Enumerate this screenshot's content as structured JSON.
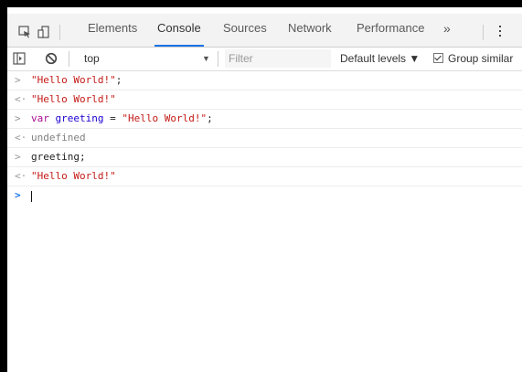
{
  "tabbar": {
    "tabs": [
      {
        "label": "Elements"
      },
      {
        "label": "Console"
      },
      {
        "label": "Sources"
      },
      {
        "label": "Network"
      },
      {
        "label": "Performance"
      }
    ],
    "more_label": "»",
    "active_tab": "Console"
  },
  "toolbar": {
    "context": "top",
    "filter_placeholder": "Filter",
    "levels_label": "Default levels ▼",
    "group_similar_label": "Group similar",
    "group_similar_checked": true
  },
  "console": {
    "rows": [
      {
        "type": "input",
        "marker": ">",
        "parts": [
          {
            "text": "\"Hello World!\"",
            "style": "str"
          },
          {
            "text": ";",
            "style": "plain"
          }
        ]
      },
      {
        "type": "output",
        "marker": "<·",
        "parts": [
          {
            "text": "\"Hello World!\"",
            "style": "str"
          }
        ]
      },
      {
        "type": "input",
        "marker": ">",
        "parts": [
          {
            "text": "var ",
            "style": "kw"
          },
          {
            "text": "greeting",
            "style": "var"
          },
          {
            "text": " = ",
            "style": "plain"
          },
          {
            "text": "\"Hello World!\"",
            "style": "str"
          },
          {
            "text": ";",
            "style": "plain"
          }
        ]
      },
      {
        "type": "output",
        "marker": "<·",
        "parts": [
          {
            "text": "undefined",
            "style": "undef"
          }
        ]
      },
      {
        "type": "input",
        "marker": ">",
        "parts": [
          {
            "text": "greeting;",
            "style": "plain"
          }
        ]
      },
      {
        "type": "output",
        "marker": "<·",
        "parts": [
          {
            "text": "\"Hello World!\"",
            "style": "str"
          }
        ]
      }
    ],
    "prompt_marker": ">"
  },
  "colors": {
    "string": "#c41a16",
    "keyword": "#aa0d91",
    "variable": "#1c00cf",
    "accent": "#1a73e8"
  }
}
